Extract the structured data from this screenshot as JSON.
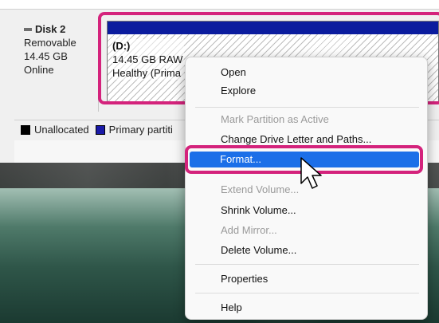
{
  "disk": {
    "name": "Disk 2",
    "type": "Removable",
    "size": "14.45 GB",
    "status": "Online"
  },
  "partition": {
    "drive": "(D:)",
    "size_fs": "14.45 GB RAW",
    "health": "Healthy (Prima"
  },
  "legend": {
    "unallocated": "Unallocated",
    "primary": "Primary partiti",
    "unallocated_color": "#000000",
    "primary_color": "#1a1aa8"
  },
  "menu": {
    "items": [
      {
        "label": "Open",
        "enabled": true
      },
      {
        "label": "Explore",
        "enabled": true
      },
      {
        "label": "Mark Partition as Active",
        "enabled": false
      },
      {
        "label": "Change Drive Letter and Paths...",
        "enabled": true
      },
      {
        "label": "Format...",
        "enabled": true,
        "highlighted": true
      },
      {
        "label": "Extend Volume...",
        "enabled": false
      },
      {
        "label": "Shrink Volume...",
        "enabled": true
      },
      {
        "label": "Add Mirror...",
        "enabled": false
      },
      {
        "label": "Delete Volume...",
        "enabled": true
      },
      {
        "label": "Properties",
        "enabled": true
      },
      {
        "label": "Help",
        "enabled": true
      }
    ]
  },
  "colors": {
    "annotation": "#d4237c",
    "selection": "#1c6fe8",
    "partition_bar": "#0b1c9e"
  },
  "icons": {
    "cursor": "arrow-cursor-icon",
    "disk": "disk-icon"
  }
}
